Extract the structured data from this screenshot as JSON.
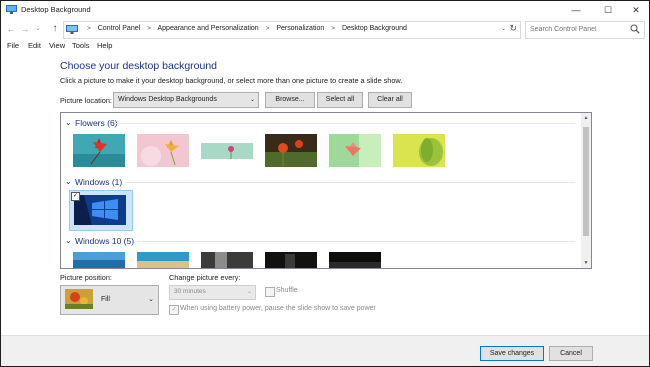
{
  "window": {
    "title": "Desktop Background"
  },
  "window_controls": {
    "minimize": "—",
    "maximize": "☐",
    "close": "✕"
  },
  "nav": {
    "back": "←",
    "forward": "→",
    "recent": "⌄",
    "up": "↑"
  },
  "address": {
    "crumbs": [
      "Control Panel",
      "Appearance and Personalization",
      "Personalization",
      "Desktop Background"
    ],
    "separator": ">",
    "dropdown": "⌄",
    "refresh": "↻"
  },
  "search": {
    "placeholder": "Search Control Panel"
  },
  "menu": {
    "items": [
      "File",
      "Edit",
      "View",
      "Tools",
      "Help"
    ]
  },
  "content": {
    "heading": "Choose your desktop background",
    "subtext": "Click a picture to make it your desktop background, or select more than one picture to create a slide show.",
    "location_label": "Picture location:",
    "location_value": "Windows Desktop Backgrounds",
    "browse_label": "Browse...",
    "select_all_label": "Select all",
    "clear_all_label": "Clear all"
  },
  "groups": [
    {
      "name": "Flowers (6)",
      "chevron": "⌄"
    },
    {
      "name": "Windows (1)",
      "chevron": "⌄"
    },
    {
      "name": "Windows 10 (5)",
      "chevron": "⌄"
    }
  ],
  "scrollbar": {
    "up": "▲",
    "down": "▼"
  },
  "selected_check": "✓",
  "position": {
    "label": "Picture position:",
    "value": "Fill",
    "arrow": "⌄"
  },
  "interval": {
    "label": "Change picture every:",
    "value": "30 minutes",
    "arrow": "⌄"
  },
  "shuffle": {
    "label": "Shuffle",
    "checked": false
  },
  "battery": {
    "label": "When using battery power, pause the slide show to save power",
    "check": "✓"
  },
  "footer": {
    "save_label": "Save changes",
    "cancel_label": "Cancel"
  }
}
